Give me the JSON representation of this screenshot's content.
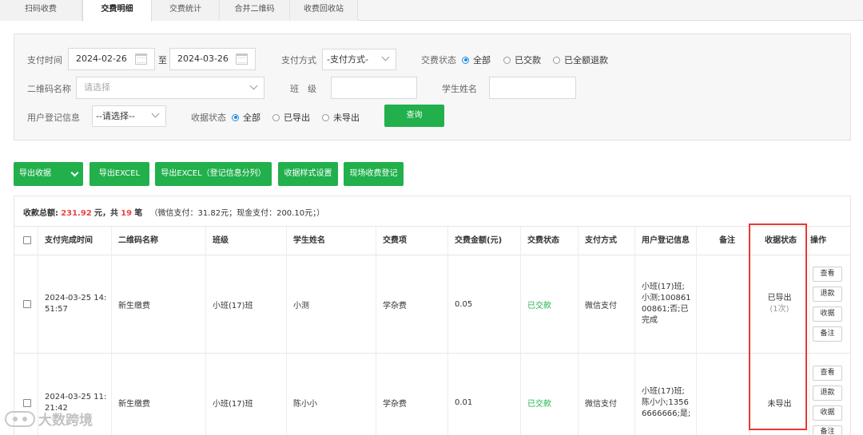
{
  "tabs": [
    "扫码收费",
    "交费明细",
    "交费统计",
    "合并二维码",
    "收费回收站"
  ],
  "filter": {
    "pay_time_label": "支付时间",
    "date_from": "2024-02-26",
    "date_sep": "至",
    "date_to": "2024-03-26",
    "pay_method_label": "支付方式",
    "pay_method_value": "-支付方式-",
    "status_label": "交费状态",
    "status_options": [
      "全部",
      "已交款",
      "已全额退款"
    ],
    "qr_label": "二维码名称",
    "qr_placeholder": "请选择",
    "class_label": "班　级",
    "student_label": "学生姓名",
    "reg_label": "用户登记信息",
    "reg_value": "--请选择--",
    "receipt_label": "收据状态",
    "receipt_options": [
      "全部",
      "已导出",
      "未导出"
    ],
    "query_button": "查询"
  },
  "actions": [
    "导出收据",
    "导出EXCEL",
    "导出EXCEL（登记信息分列）",
    "收据样式设置",
    "现场收费登记"
  ],
  "summary": {
    "prefix": "收款总额:",
    "total": "231.92",
    "mid": "元，共",
    "count": "19",
    "suffix": "笔",
    "detail": "（微信支付：31.82元；现金支付：200.10元；）"
  },
  "table": {
    "headers": [
      "支付完成时间",
      "二维码名称",
      "班级",
      "学生姓名",
      "交费项",
      "交费金额(元)",
      "交费状态",
      "支付方式",
      "用户登记信息",
      "备注",
      "收据状态",
      "操作"
    ],
    "rows": [
      {
        "time_1": "2024-03-25 14:",
        "time_2": "51:57",
        "qr": "新生缴费",
        "class": "小班(17)班",
        "student": "小测",
        "item": "学杂费",
        "amount": "0.05",
        "status": "已交款",
        "method": "微信支付",
        "reg_lines": [
          "小班(17)班;",
          "小测;100861",
          "00861;否;已",
          "完成"
        ],
        "note": "",
        "receipt": "已导出",
        "receipt_count": "(1次)",
        "ops": [
          "查看",
          "退款",
          "收据",
          "备注"
        ]
      },
      {
        "time_1": "2024-03-25 11:",
        "time_2": "21:42",
        "qr": "新生缴费",
        "class": "小班(17)班",
        "student": "陈小小",
        "item": "学杂费",
        "amount": "0.01",
        "status": "已交款",
        "method": "微信支付",
        "reg_lines": [
          "小班(17)班;",
          "陈小小;1356",
          "6666666;是;"
        ],
        "note": "",
        "receipt": "未导出",
        "receipt_count": "",
        "ops": [
          "查看",
          "退款",
          "收据",
          "备注"
        ]
      }
    ]
  },
  "watermark": "大数跨境"
}
